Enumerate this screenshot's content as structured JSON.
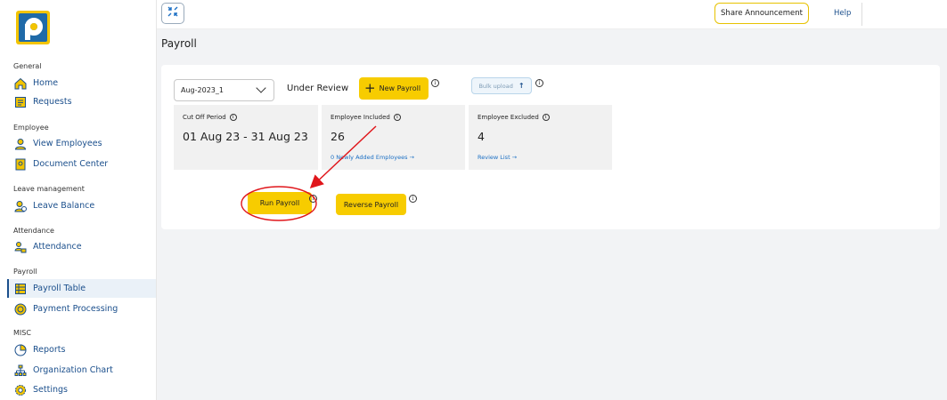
{
  "sidebar": {
    "sections": [
      {
        "title": "General",
        "items": [
          {
            "label": "Home",
            "icon": "home-icon"
          },
          {
            "label": "Requests",
            "icon": "requests-icon"
          }
        ]
      },
      {
        "title": "Employee",
        "items": [
          {
            "label": "View Employees",
            "icon": "user-icon"
          },
          {
            "label": "Document Center",
            "icon": "document-icon"
          }
        ]
      },
      {
        "title": "Leave management",
        "items": [
          {
            "label": "Leave Balance",
            "icon": "leave-balance-icon"
          }
        ]
      },
      {
        "title": "Attendance",
        "items": [
          {
            "label": "Attendance",
            "icon": "attendance-icon"
          }
        ]
      },
      {
        "title": "Payroll",
        "items": [
          {
            "label": "Payroll Table",
            "icon": "payroll-table-icon",
            "active": true
          },
          {
            "label": "Payment Processing",
            "icon": "payment-icon"
          }
        ]
      },
      {
        "title": "MISC",
        "items": [
          {
            "label": "Reports",
            "icon": "reports-icon"
          },
          {
            "label": "Organization Chart",
            "icon": "org-chart-icon"
          },
          {
            "label": "Settings",
            "icon": "settings-icon"
          }
        ]
      }
    ]
  },
  "topbar": {
    "share_label": "Share Announcement",
    "help_label": "Help"
  },
  "page": {
    "title": "Payroll"
  },
  "controls": {
    "month": "Aug-2023_1",
    "status": "Under Review",
    "new_payroll_label": "New Payroll",
    "bulk_upload_label": "Bulk upload",
    "run_payroll_label": "Run Payroll",
    "reverse_payroll_label": "Reverse Payroll"
  },
  "stats": {
    "cutoff": {
      "label": "Cut Off Period",
      "value": "01 Aug 23 - 31 Aug 23"
    },
    "included": {
      "label": "Employee Included",
      "value": "26",
      "link": "0 Newly Added Employees →"
    },
    "excluded": {
      "label": "Employee Excluded",
      "value": "4",
      "link": "Review List →"
    }
  },
  "colors": {
    "accent_yellow": "#f7cc00",
    "nav_blue": "#1b4f8c",
    "link_blue": "#1b6fc4",
    "annotation_red": "#e0161b"
  }
}
